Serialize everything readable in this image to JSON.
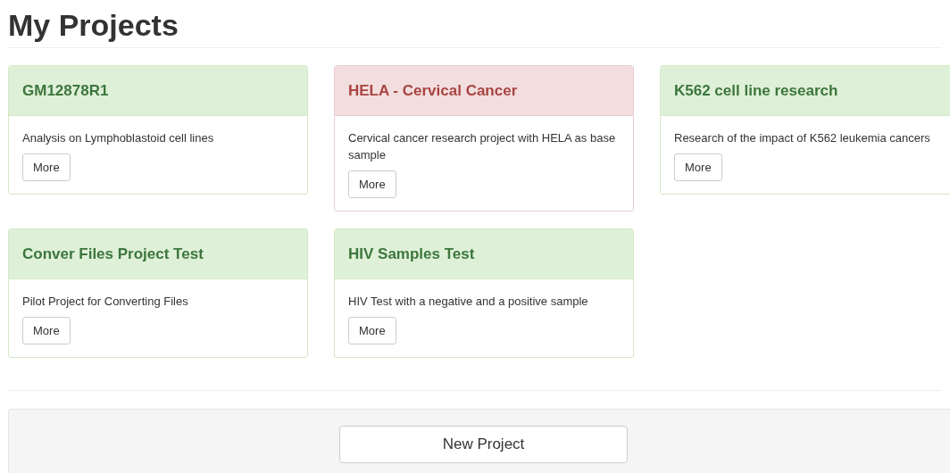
{
  "title": "My Projects",
  "projects": [
    {
      "name": "GM12878R1",
      "description": "Analysis on Lymphoblastoid cell lines",
      "button": "More",
      "color": "#dff0d8"
    },
    {
      "name": "HELA - Cervical Cancer",
      "description": "Cervical cancer research project with HELA as base sample",
      "button": "More",
      "color": "#f2dede"
    },
    {
      "name": "K562 cell line research",
      "description": "Research of the impact of K562 leukemia cancers",
      "button": "More",
      "color": "#dff0d8"
    },
    {
      "name": "Conver Files Project Test",
      "description": "Pilot Project for Converting Files",
      "button": "More",
      "color": "#dff0d8"
    },
    {
      "name": "HIV Samples Test",
      "description": "HIV Test with a negative and a positive sample",
      "button": "More",
      "color": "#dff0d8"
    }
  ],
  "new_project_button": "New Project"
}
